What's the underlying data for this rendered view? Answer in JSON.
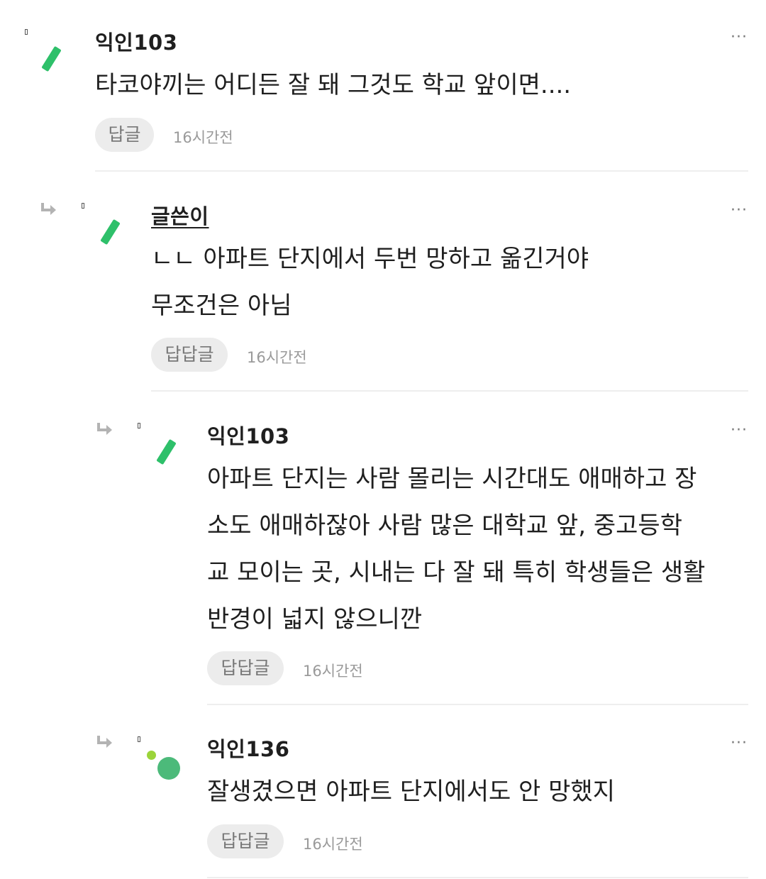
{
  "comments": [
    {
      "author": "익인103",
      "text": "타코야끼는 어디든 잘 돼 그것도 학교 앞이면....",
      "reply_label": "답글",
      "time": "16시간전",
      "more": "···",
      "is_reply": false,
      "is_op": false,
      "avatar": "green-bar"
    },
    {
      "author": "글쓴이",
      "text": "ㄴㄴ 아파트 단지에서 두번 망하고 옮긴거야\n무조건은 아님",
      "reply_label": "답답글",
      "time": "16시간전",
      "more": "···",
      "is_reply": true,
      "is_op": true,
      "avatar": "green-bar"
    },
    {
      "author": "익인103",
      "text": "아파트 단지는 사람 몰리는 시간대도 애매하고 장\n소도 애매하잖아 사람 많은 대학교 앞, 중고등학\n교 모이는 곳, 시내는 다 잘 돼 특히 학생들은 생활\n반경이 넓지 않으니깐",
      "reply_label": "답답글",
      "time": "16시간전",
      "more": "···",
      "is_reply": true,
      "is_op": false,
      "avatar": "green-bar"
    },
    {
      "author": "익인136",
      "text": "잘생겼으면 아파트 단지에서도 안 망했지",
      "reply_label": "답답글",
      "time": "16시간전",
      "more": "···",
      "is_reply": true,
      "is_op": false,
      "avatar": "green-circle"
    }
  ],
  "colors": {
    "avatar_green": "#2ec06a",
    "avatar_circle": "#4cba7a",
    "avatar_mini": "#9bd43a",
    "button_bg": "#ececec",
    "divider": "#eeeeee"
  },
  "icons": {
    "reply_indicator": "reply-arrow-icon",
    "more": "more-options-icon"
  }
}
